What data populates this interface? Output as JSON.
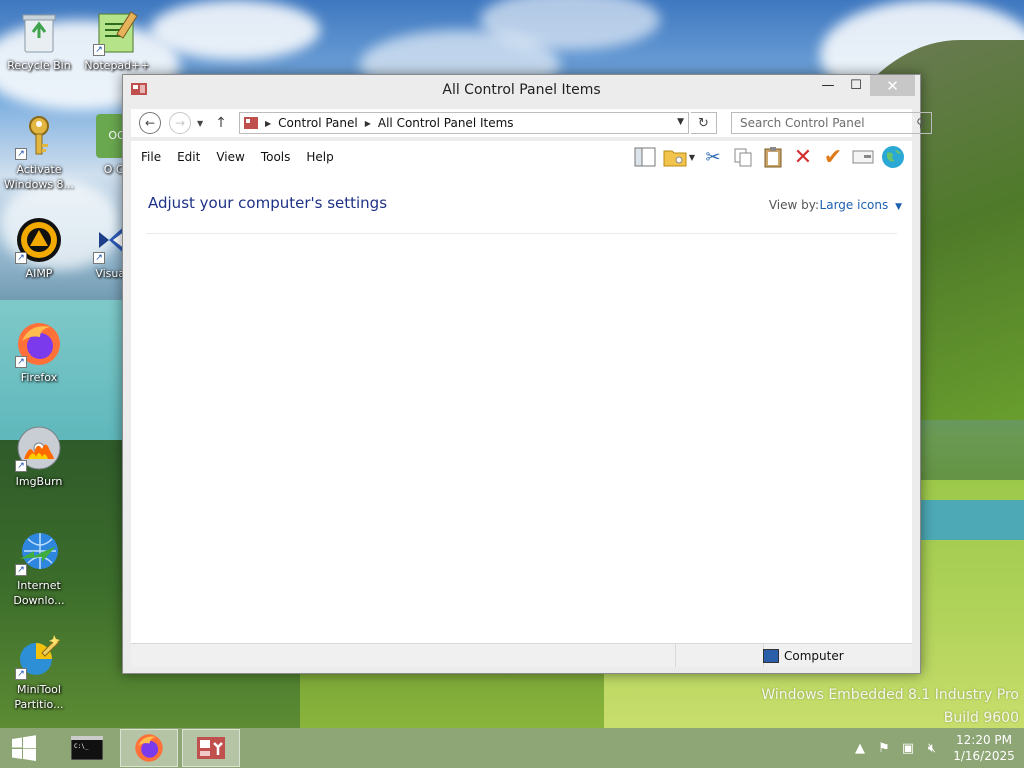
{
  "desktop": {
    "icons": [
      {
        "label": "Recycle Bin",
        "icon": "recycle-bin-icon"
      },
      {
        "label": "Notepad++",
        "icon": "notepad-plus-plus-icon"
      },
      {
        "label": "Activate Windows 8...",
        "icon": "key-icon"
      },
      {
        "label": "O Ca",
        "icon": "app-icon"
      },
      {
        "label": "AIMP",
        "icon": "aimp-icon"
      },
      {
        "label": "Visual S",
        "icon": "visual-studio-icon"
      },
      {
        "label": "Firefox",
        "icon": "firefox-icon"
      },
      {
        "label": "ImgBurn",
        "icon": "imgburn-icon"
      },
      {
        "label": "Internet Downlo...",
        "icon": "internet-download-manager-icon"
      },
      {
        "label": "MiniTool Partitio...",
        "icon": "minitool-partition-icon"
      }
    ],
    "watermark_line1": "Windows Embedded 8.1 Industry Pro",
    "watermark_line2": "Build 9600"
  },
  "window": {
    "title": "All Control Panel Items",
    "minimize": "—",
    "maximize": "☐",
    "close": "✕",
    "breadcrumb": [
      "Control Panel",
      "All Control Panel Items"
    ],
    "search_placeholder": "Search Control Panel",
    "menu": [
      "File",
      "Edit",
      "View",
      "Tools",
      "Help"
    ],
    "heading": "Adjust your computer's settings",
    "view_by_label": "View by:",
    "view_by_value": "Large icons",
    "status_text": "Computer"
  },
  "taskbar": {
    "clock_time": "12:20 PM",
    "clock_date": "1/16/2025"
  },
  "colors": {
    "heading": "#1e3287",
    "link": "#1e5fb0"
  }
}
